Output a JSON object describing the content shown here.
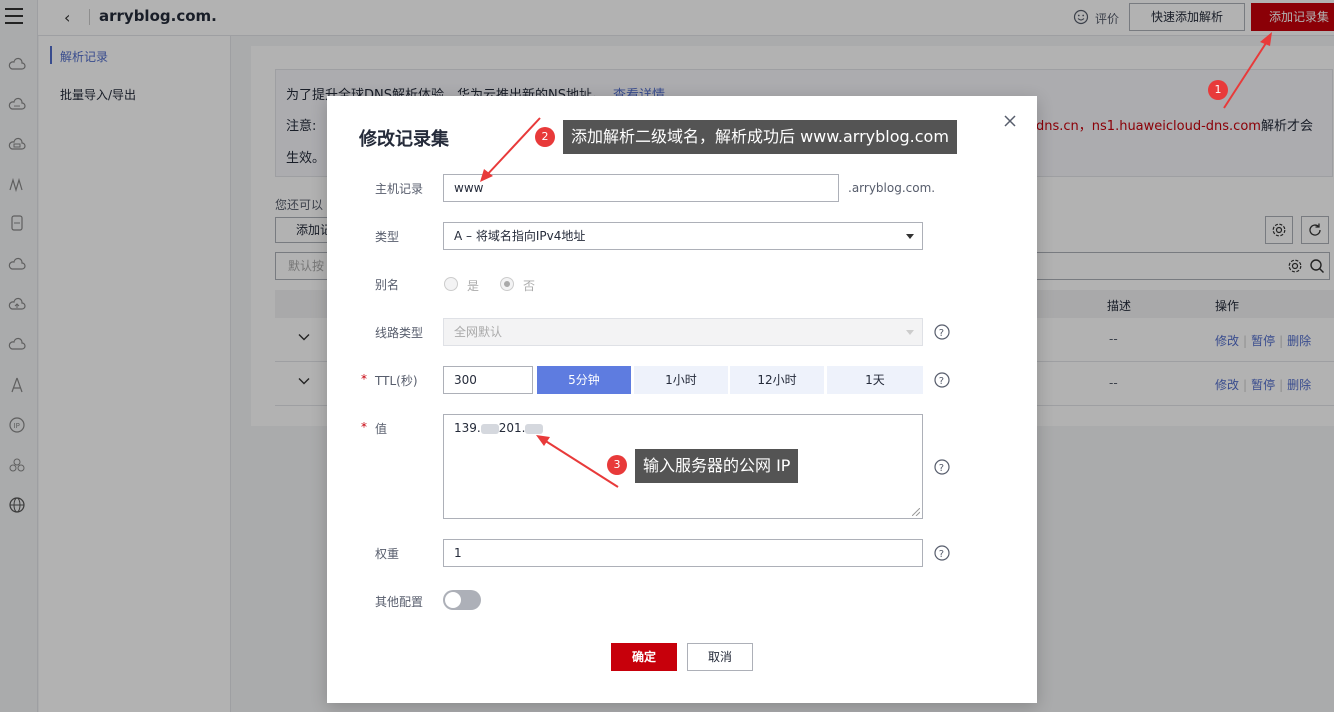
{
  "header": {
    "back_icon": "chevron-left-icon",
    "domain": "arryblog.com.",
    "rate_label": "评价",
    "quick_add_label": "快速添加解析",
    "add_recordset_label": "添加记录集"
  },
  "subnav": {
    "items": [
      {
        "label": "解析记录",
        "active": true
      },
      {
        "label": "批量导入/导出",
        "active": false
      }
    ]
  },
  "notice": {
    "line1": "为了提升全球DNS解析体验，华为云推出新的NS地址。",
    "line1_link": "查看详情",
    "line2_prefix": "注意:",
    "line2_ns": "dns.cn，ns1.huaweicloud-dns.com",
    "line2_suffix": "解析才会",
    "line3": "生效。"
  },
  "main": {
    "can_text": "您还可以",
    "add_record_btn": "添加记",
    "search_placeholder": "默认按",
    "table": {
      "headers": [
        "描述",
        "操作"
      ],
      "rows": [
        {
          "desc": "--",
          "ops": [
            "修改",
            "暂停",
            "删除"
          ]
        },
        {
          "desc": "--",
          "ops": [
            "修改",
            "暂停",
            "删除"
          ]
        }
      ]
    }
  },
  "modal": {
    "title": "修改记录集",
    "host_label": "主机记录",
    "host_value": "www",
    "host_suffix": ".arryblog.com.",
    "type_label": "类型",
    "type_value": "A – 将域名指向IPv4地址",
    "alias_label": "别名",
    "alias_yes": "是",
    "alias_no": "否",
    "line_label": "线路类型",
    "line_value": "全网默认",
    "ttl_label": "TTL(秒)",
    "ttl_value": "300",
    "ttl_options": [
      "5分钟",
      "1小时",
      "12小时",
      "1天"
    ],
    "ttl_selected": "5分钟",
    "value_label": "值",
    "value_prefix": "139.",
    "value_mid": "201.",
    "weight_label": "权重",
    "weight_value": "1",
    "other_label": "其他配置",
    "ok_label": "确定",
    "cancel_label": "取消"
  },
  "annotations": [
    {
      "num": "1",
      "text": ""
    },
    {
      "num": "2",
      "text": "添加解析二级域名，解析成功后 www.arryblog.com"
    },
    {
      "num": "3",
      "text": "输入服务器的公网 IP"
    }
  ],
  "colors": {
    "brand_red": "#c7000b",
    "link_blue": "#526ecc",
    "selected_segment": "#5e7ce0"
  }
}
